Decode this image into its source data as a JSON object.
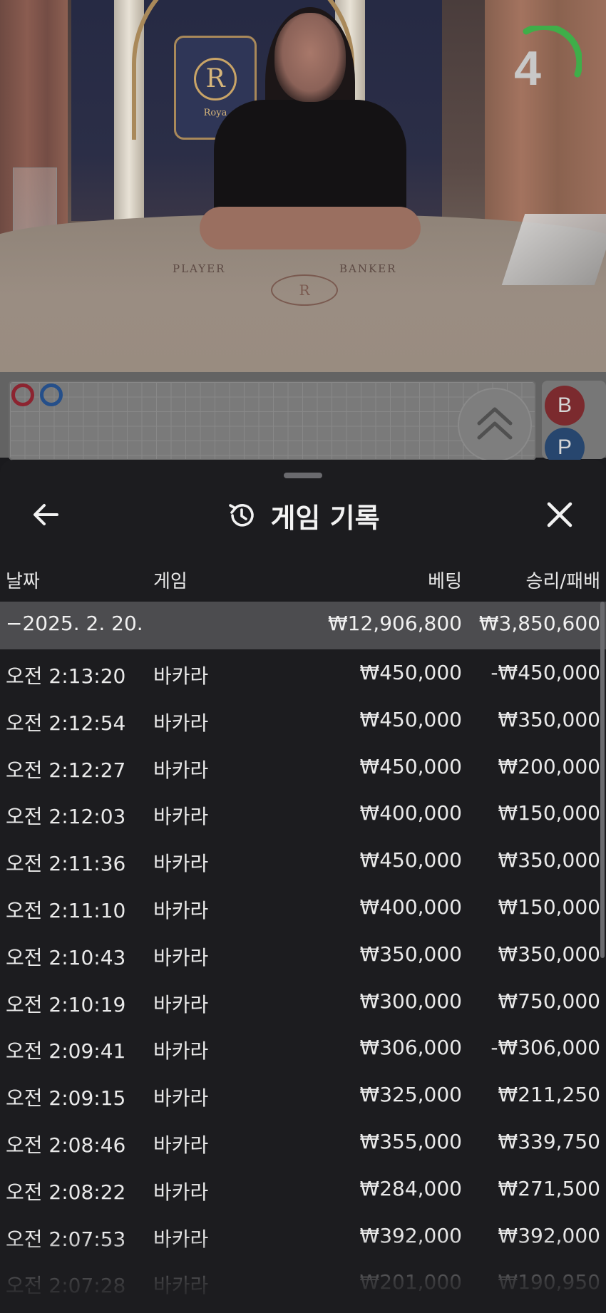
{
  "video": {
    "timer_value": "4",
    "crest_letter": "R",
    "crest_word": "Roya",
    "table_player_label": "PLAYER",
    "table_banker_label": "BANKER",
    "table_logo": "R"
  },
  "roadmap": {
    "banker_button": "B",
    "player_button": "P"
  },
  "sheet": {
    "title": "게임 기록",
    "title_icon": "history-icon",
    "back_icon": "arrow-left-icon",
    "close_icon": "close-icon",
    "columns": {
      "date": "날짜",
      "game": "게임",
      "bet": "베팅",
      "win_loss": "승리/패배"
    },
    "summary": {
      "date": "−2025. 2. 20.",
      "bet_total": "₩12,906,800",
      "win_total": "₩3,850,600"
    },
    "rows": [
      {
        "time": "오전 2:13:20",
        "game": "바카라",
        "bet": "₩450,000",
        "result": "-₩450,000"
      },
      {
        "time": "오전 2:12:54",
        "game": "바카라",
        "bet": "₩450,000",
        "result": "₩350,000"
      },
      {
        "time": "오전 2:12:27",
        "game": "바카라",
        "bet": "₩450,000",
        "result": "₩200,000"
      },
      {
        "time": "오전 2:12:03",
        "game": "바카라",
        "bet": "₩400,000",
        "result": "₩150,000"
      },
      {
        "time": "오전 2:11:36",
        "game": "바카라",
        "bet": "₩450,000",
        "result": "₩350,000"
      },
      {
        "time": "오전 2:11:10",
        "game": "바카라",
        "bet": "₩400,000",
        "result": "₩150,000"
      },
      {
        "time": "오전 2:10:43",
        "game": "바카라",
        "bet": "₩350,000",
        "result": "₩350,000"
      },
      {
        "time": "오전 2:10:19",
        "game": "바카라",
        "bet": "₩300,000",
        "result": "₩750,000"
      },
      {
        "time": "오전 2:09:41",
        "game": "바카라",
        "bet": "₩306,000",
        "result": "-₩306,000"
      },
      {
        "time": "오전 2:09:15",
        "game": "바카라",
        "bet": "₩325,000",
        "result": "₩211,250"
      },
      {
        "time": "오전 2:08:46",
        "game": "바카라",
        "bet": "₩355,000",
        "result": "₩339,750"
      },
      {
        "time": "오전 2:08:22",
        "game": "바카라",
        "bet": "₩284,000",
        "result": "₩271,500"
      },
      {
        "time": "오전 2:07:53",
        "game": "바카라",
        "bet": "₩392,000",
        "result": "₩392,000"
      },
      {
        "time": "오전 2:07:28",
        "game": "바카라",
        "bet": "₩201,000",
        "result": "₩190,950"
      }
    ]
  },
  "colors": {
    "sheet_bg": "#1c1c1f",
    "summary_bg": "#4c4c4f",
    "timer_arc": "#3fae49",
    "banker": "#c8262f",
    "player": "#2a6fcf"
  }
}
